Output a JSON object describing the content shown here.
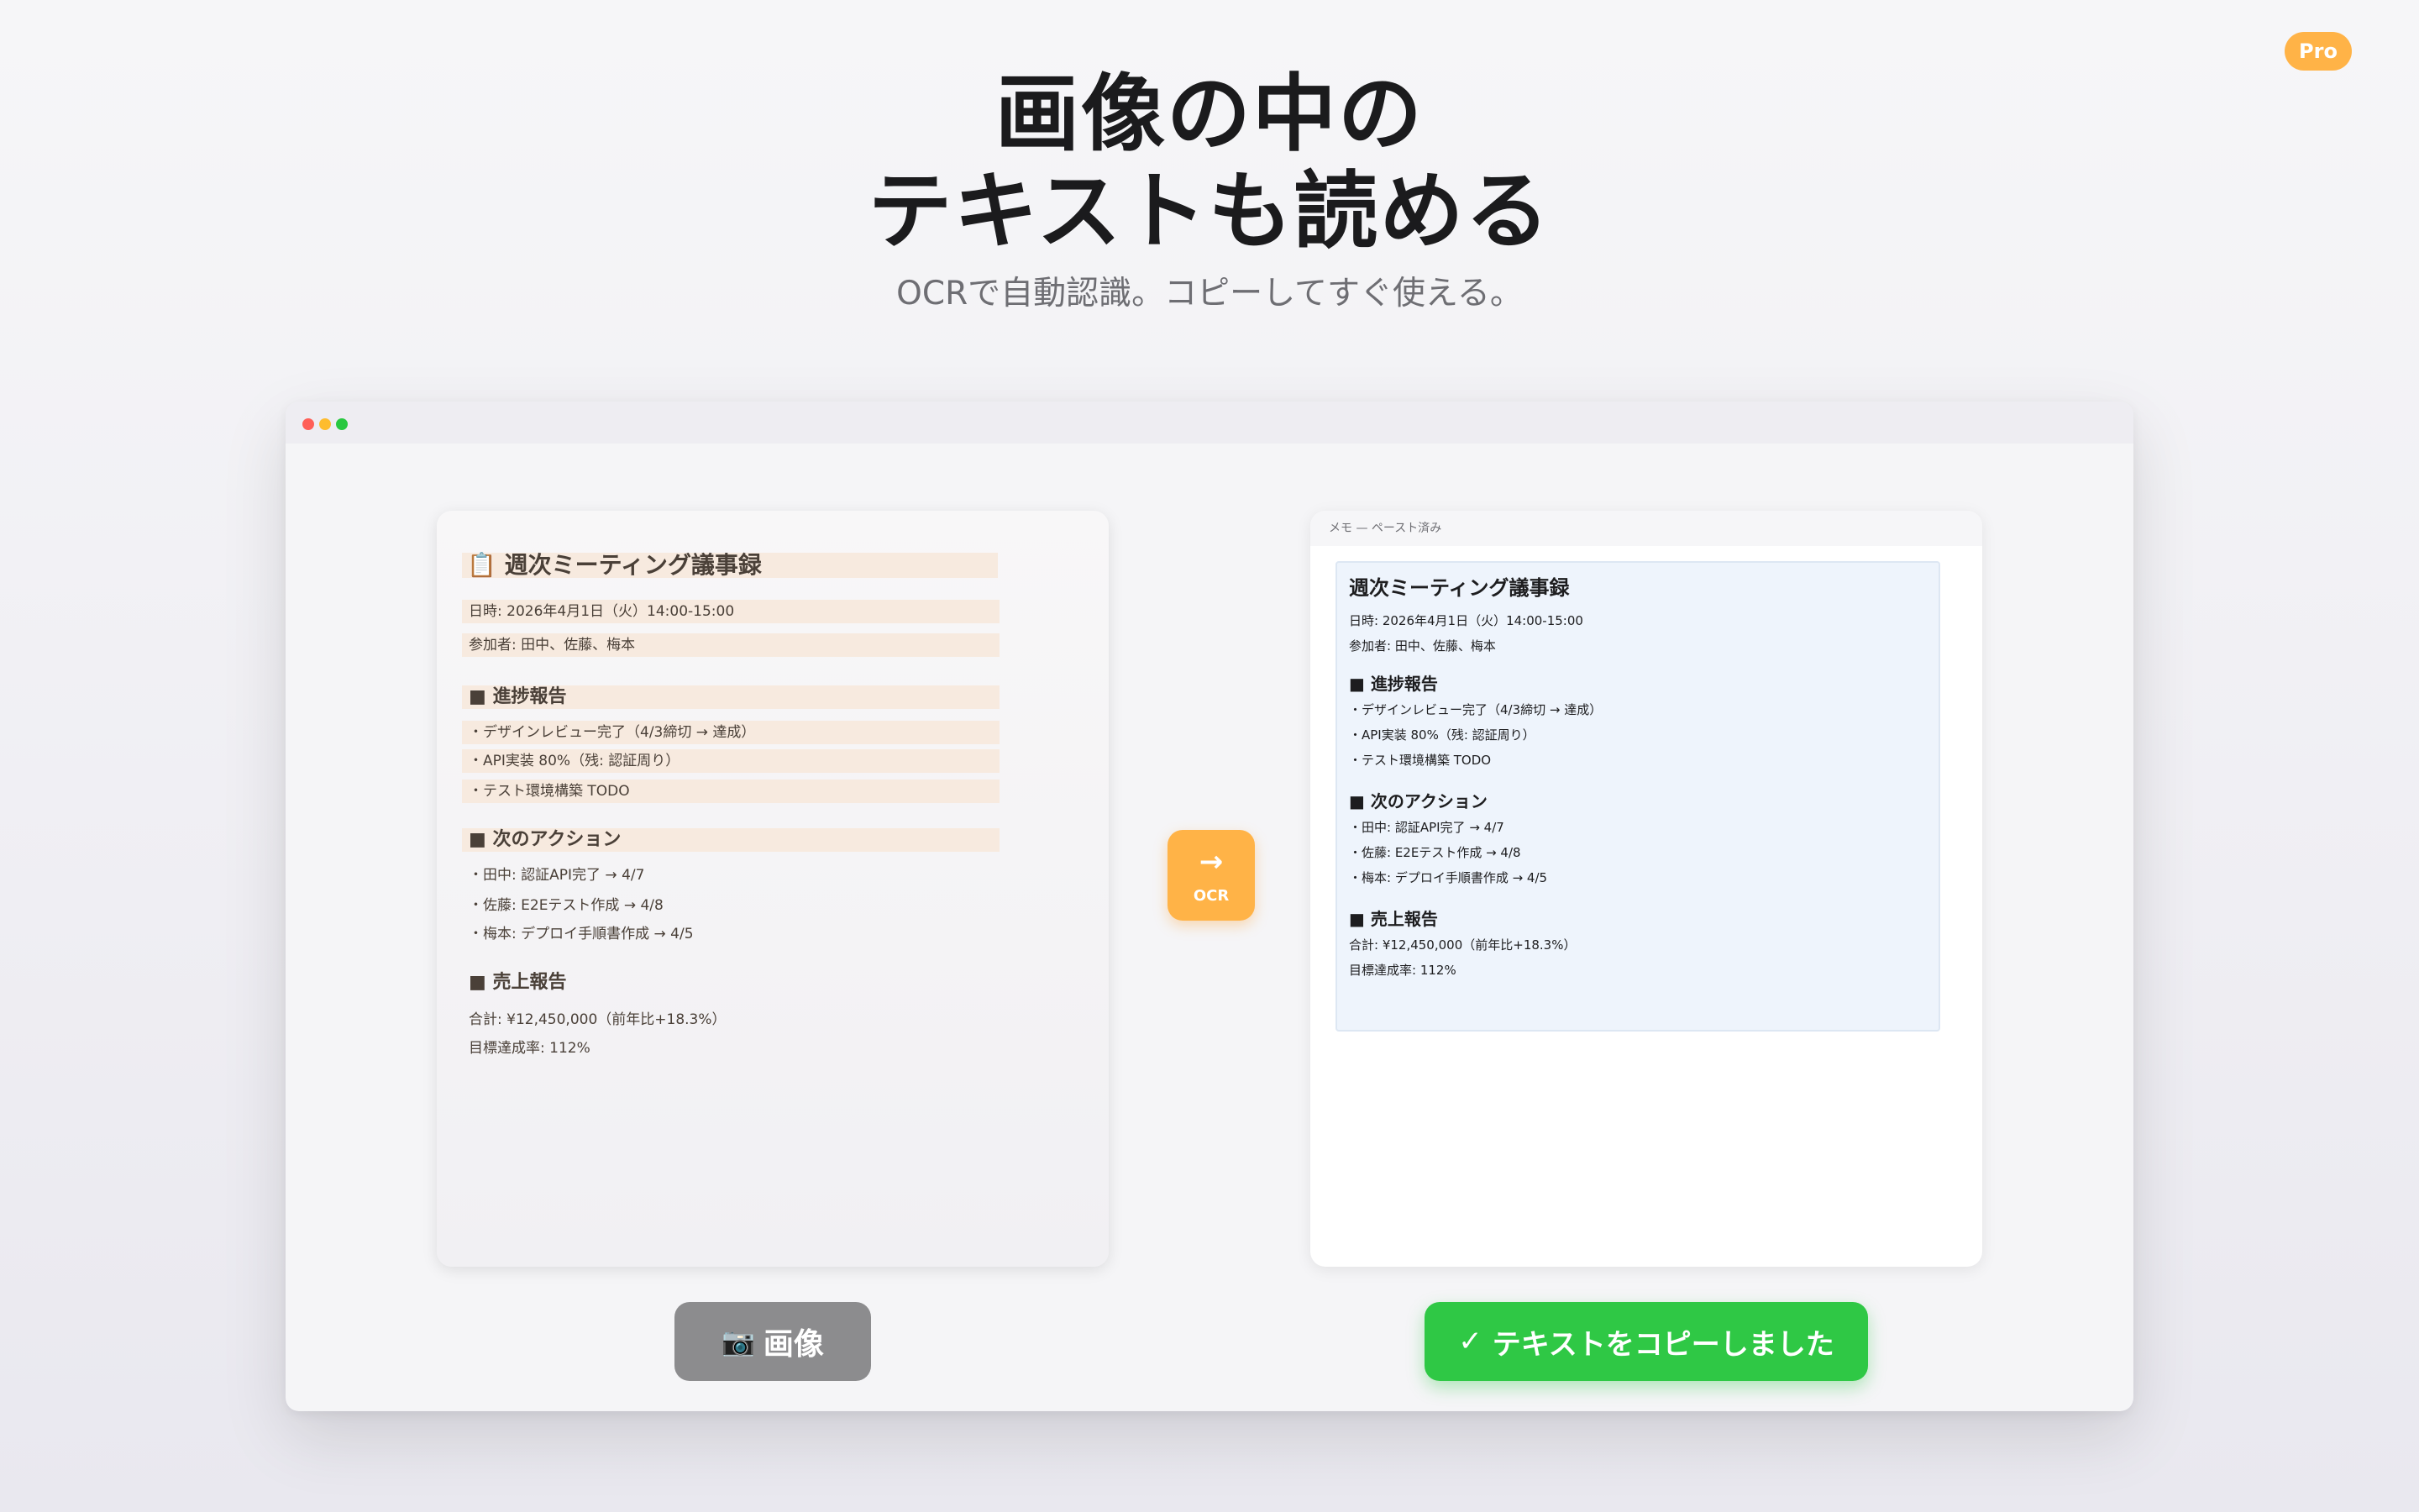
{
  "badge": {
    "label": "Pro",
    "color": "#ffb347"
  },
  "hero": {
    "title_line1": "画像の中の",
    "title_line2": "テキストも読める",
    "subtitle": "OCRで自動認識。コピーしてすぐ使える。"
  },
  "window": {
    "traffic_lights": [
      "#ff5f57",
      "#febc2e",
      "#28c840"
    ]
  },
  "image_card": {
    "title": "📋 週次ミーティング議事録",
    "date": "日時: 2026年4月1日（火）14:00-15:00",
    "attendees": "参加者: 田中、佐藤、梅本",
    "progress_heading": "■ 進捗報告",
    "progress_items": [
      "・デザインレビュー完了（4/3締切 → 達成）",
      "・API実装 80%（残: 認証周り）",
      "・テスト環境構築 TODO"
    ],
    "actions_heading": "■ 次のアクション",
    "action_items": [
      "・田中: 認証API完了 → 4/7",
      "・佐藤: E2Eテスト作成 → 4/8",
      "・梅本: デプロイ手順書作成 → 4/5"
    ],
    "sales_heading": "■ 売上報告",
    "sales_items": [
      "合計: ¥12,450,000（前年比+18.3%）",
      "目標達成率: 112%"
    ]
  },
  "ocr_button": {
    "icon": "arrow-right-icon",
    "glyph": "→",
    "label": "OCR"
  },
  "memo": {
    "header": "メモ — ペースト済み",
    "title": "週次ミーティング議事録",
    "date": "日時: 2026年4月1日（火）14:00-15:00",
    "attendees": "参加者: 田中、佐藤、梅本",
    "progress_heading": "■ 進捗報告",
    "progress_items": [
      "・デザインレビュー完了（4/3締切 → 達成）",
      "・API実装 80%（残: 認証周り）",
      "・テスト環境構築 TODO"
    ],
    "actions_heading": "■ 次のアクション",
    "action_items": [
      "・田中: 認証API完了 → 4/7",
      "・佐藤: E2Eテスト作成 → 4/8",
      "・梅本: デプロイ手順書作成 → 4/5"
    ],
    "sales_heading": "■ 売上報告",
    "sales_items": [
      "合計: ¥12,450,000（前年比+18.3%）",
      "目標達成率: 112%"
    ]
  },
  "buttons": {
    "image_icon": "camera-icon",
    "image_glyph": "📷",
    "image_label": "画像",
    "copy_icon": "checkmark-icon",
    "copy_glyph": "✓",
    "copy_label": "テキストをコピーしました",
    "copy_color": "#2fc845"
  }
}
